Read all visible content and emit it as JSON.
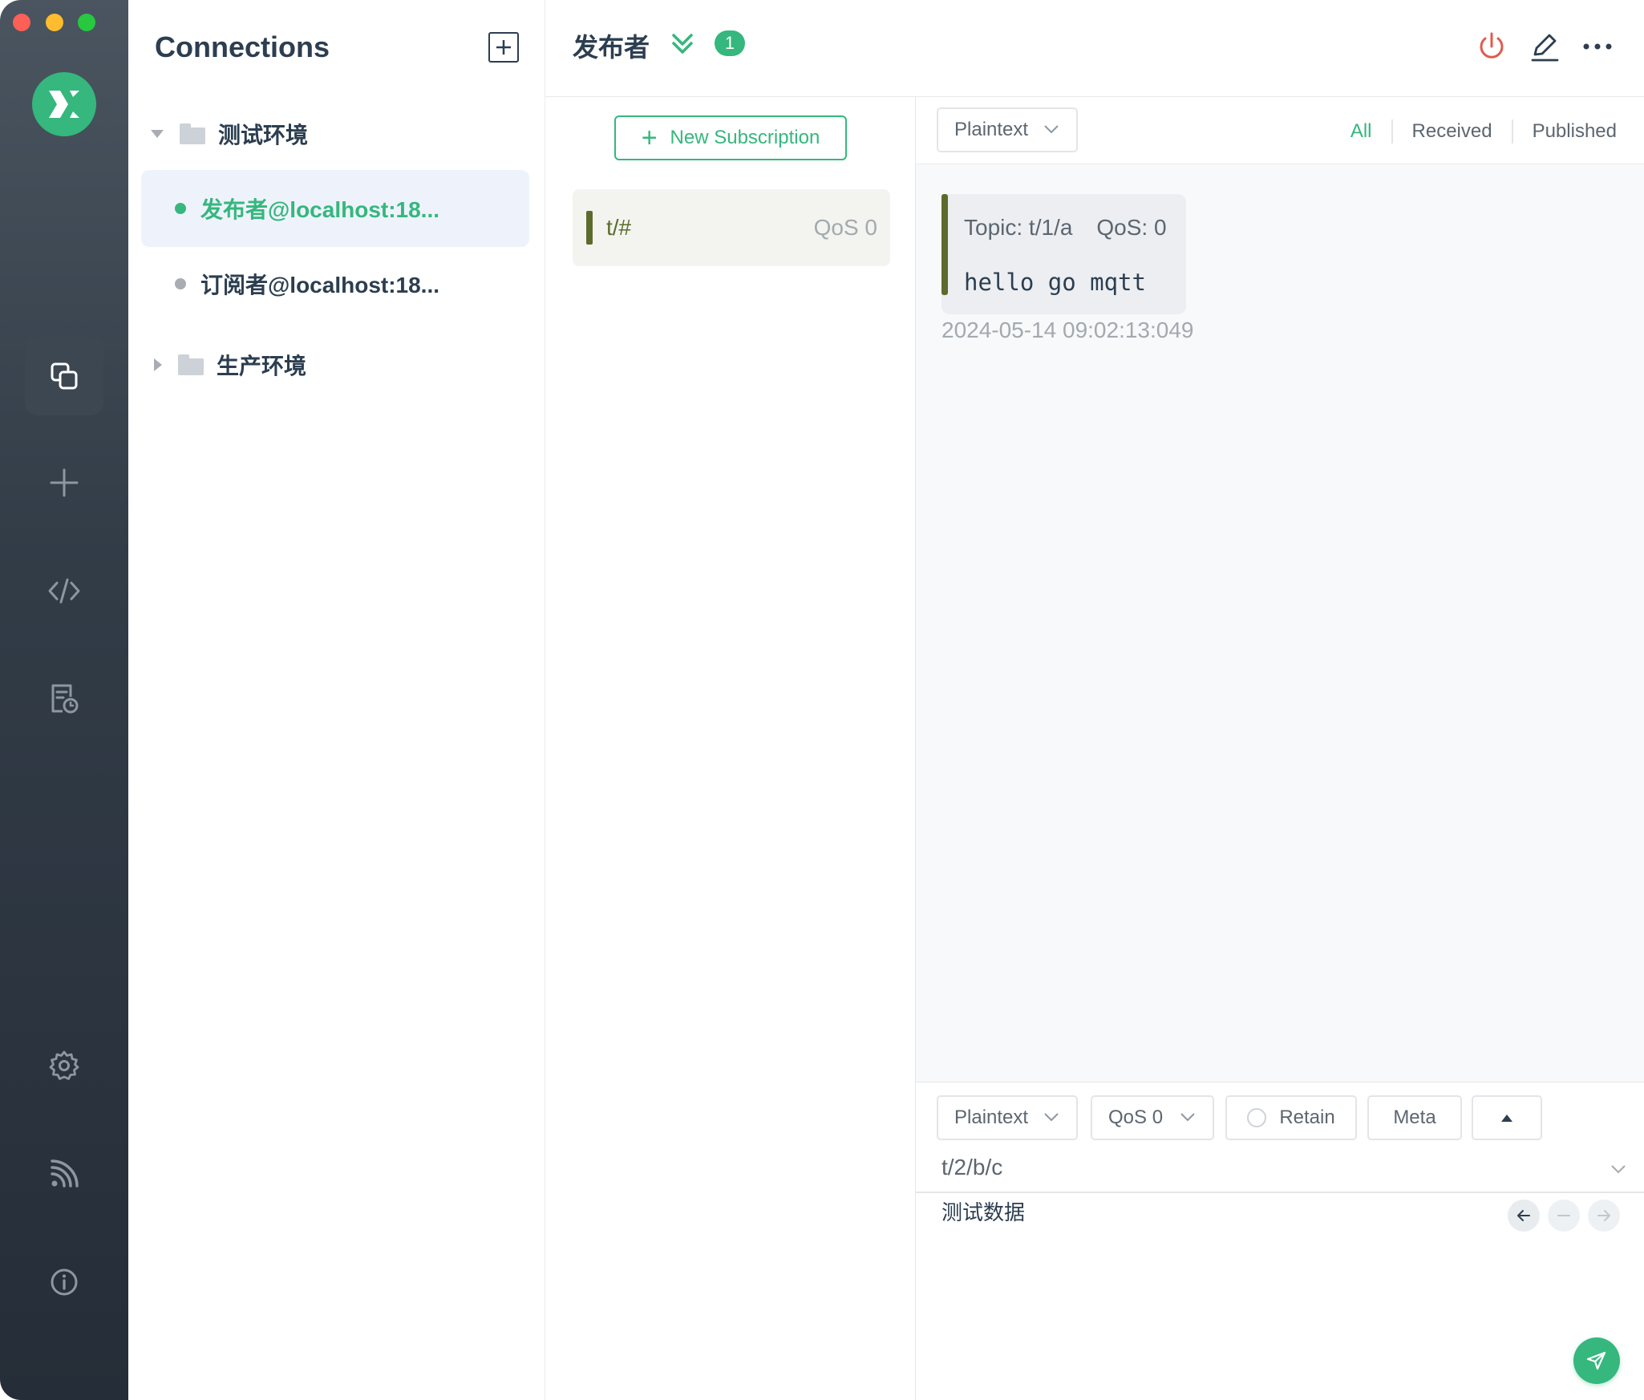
{
  "window": {
    "traffic_lights": [
      "close",
      "minimize",
      "zoom"
    ]
  },
  "rail": {
    "logo": "mqttx-logo",
    "items": [
      {
        "icon": "connections-icon",
        "active": true
      },
      {
        "icon": "plus-icon",
        "active": false
      },
      {
        "icon": "code-icon",
        "active": false
      },
      {
        "icon": "log-icon",
        "active": false
      },
      {
        "icon": "gear-icon",
        "active": false
      },
      {
        "icon": "feed-icon",
        "active": false
      },
      {
        "icon": "info-icon",
        "active": false
      }
    ]
  },
  "connections": {
    "title": "Connections",
    "groups": [
      {
        "name": "测试环境",
        "expanded": true,
        "items": [
          {
            "label": "发布者@localhost:18...",
            "status": "connected",
            "active": true
          },
          {
            "label": "订阅者@localhost:18...",
            "status": "disconnected",
            "active": false
          }
        ]
      },
      {
        "name": "生产环境",
        "expanded": false,
        "items": []
      }
    ]
  },
  "header": {
    "title": "发布者",
    "badge": "1"
  },
  "subscriptions": {
    "new_label": "New Subscription",
    "items": [
      {
        "topic": "t/#",
        "qos": "QoS 0"
      }
    ]
  },
  "messages": {
    "format": "Plaintext",
    "filters": [
      "All",
      "Received",
      "Published"
    ],
    "active_filter": "All",
    "list": [
      {
        "topic": "Topic: t/1/a",
        "qos": "QoS: 0",
        "payload": "hello go mqtt",
        "time": "2024-05-14 09:02:13:049"
      }
    ]
  },
  "publish": {
    "format": "Plaintext",
    "qos": "QoS 0",
    "retain_label": "Retain",
    "meta_label": "Meta",
    "topic": "t/2/b/c",
    "payload": "测试数据"
  },
  "colors": {
    "accent": "#35b77d",
    "rail_bg": "#2c3540",
    "subscription_color": "#5b6b2b",
    "danger": "#e05b4f"
  }
}
